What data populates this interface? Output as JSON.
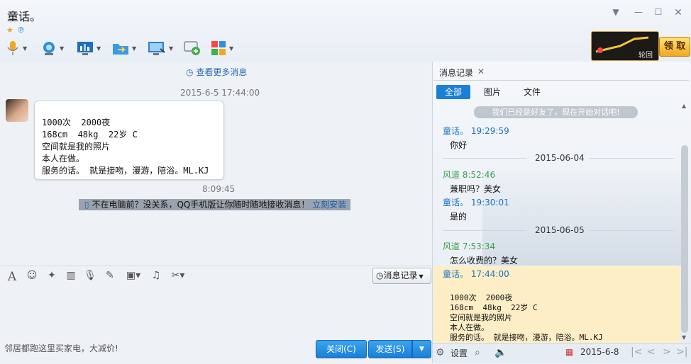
{
  "window": {
    "title": "童话。"
  },
  "toolbar": {
    "items": [
      "microphone-icon",
      "camera-icon",
      "screen-share-icon",
      "file-transfer-icon",
      "remote-desktop-icon",
      "add-chat-icon",
      "apps-icon"
    ]
  },
  "promo": {
    "label": "轮回",
    "button": "领 取"
  },
  "chat": {
    "more_link": "查看更多消息",
    "time1": "2015-6-5 17:44:00",
    "bubble_lines": [
      "1000次  2000夜",
      "168cm  48kg  22岁 C",
      "空间就是我的照片",
      "本人在做。",
      "服务的话。 就是接吻，漫游，陪浴。ML.KJ"
    ],
    "time2": "8:09:45",
    "promo_text": "不在电脑前？没关系，QQ手机版让你随时随地接收消息！",
    "promo_link": "立刻安装"
  },
  "input_toolbar": {
    "history_label": "消息记录"
  },
  "bottom": {
    "hint": "邻居都跑这里买家电，大减价!",
    "close_label": "关闭(C)",
    "send_label": "发送(S)"
  },
  "panel": {
    "tab_label": "消息记录",
    "filters": [
      "全部",
      "图片",
      "文件"
    ],
    "system_msg": "我们已经是好友了，现在开始对话吧!",
    "entries": [
      {
        "sender": "童话。 19:29:59",
        "text": "你好"
      },
      {
        "date": "2015-06-04"
      },
      {
        "sender": "风道 8:52:46",
        "text": "兼职吗？美女"
      },
      {
        "sender": "童话。 19:30:01",
        "text": "是的"
      },
      {
        "date": "2015-06-05"
      },
      {
        "sender": "风道 7:53:34",
        "text": "怎么收费的？美女"
      },
      {
        "sender": "童话。 17:44:00"
      }
    ],
    "hl_lines": [
      "1000次  2000夜",
      "168cm  48kg  22岁 C",
      "空间就是我的照片",
      "本人在做。",
      "服务的话。 就是接吻，漫游，陪浴。ML.KJ"
    ],
    "footer": {
      "settings": "设置",
      "date": "2015-6-8"
    },
    "colors": {
      "self": "#1a73c8",
      "other": "#3aa04a"
    }
  }
}
